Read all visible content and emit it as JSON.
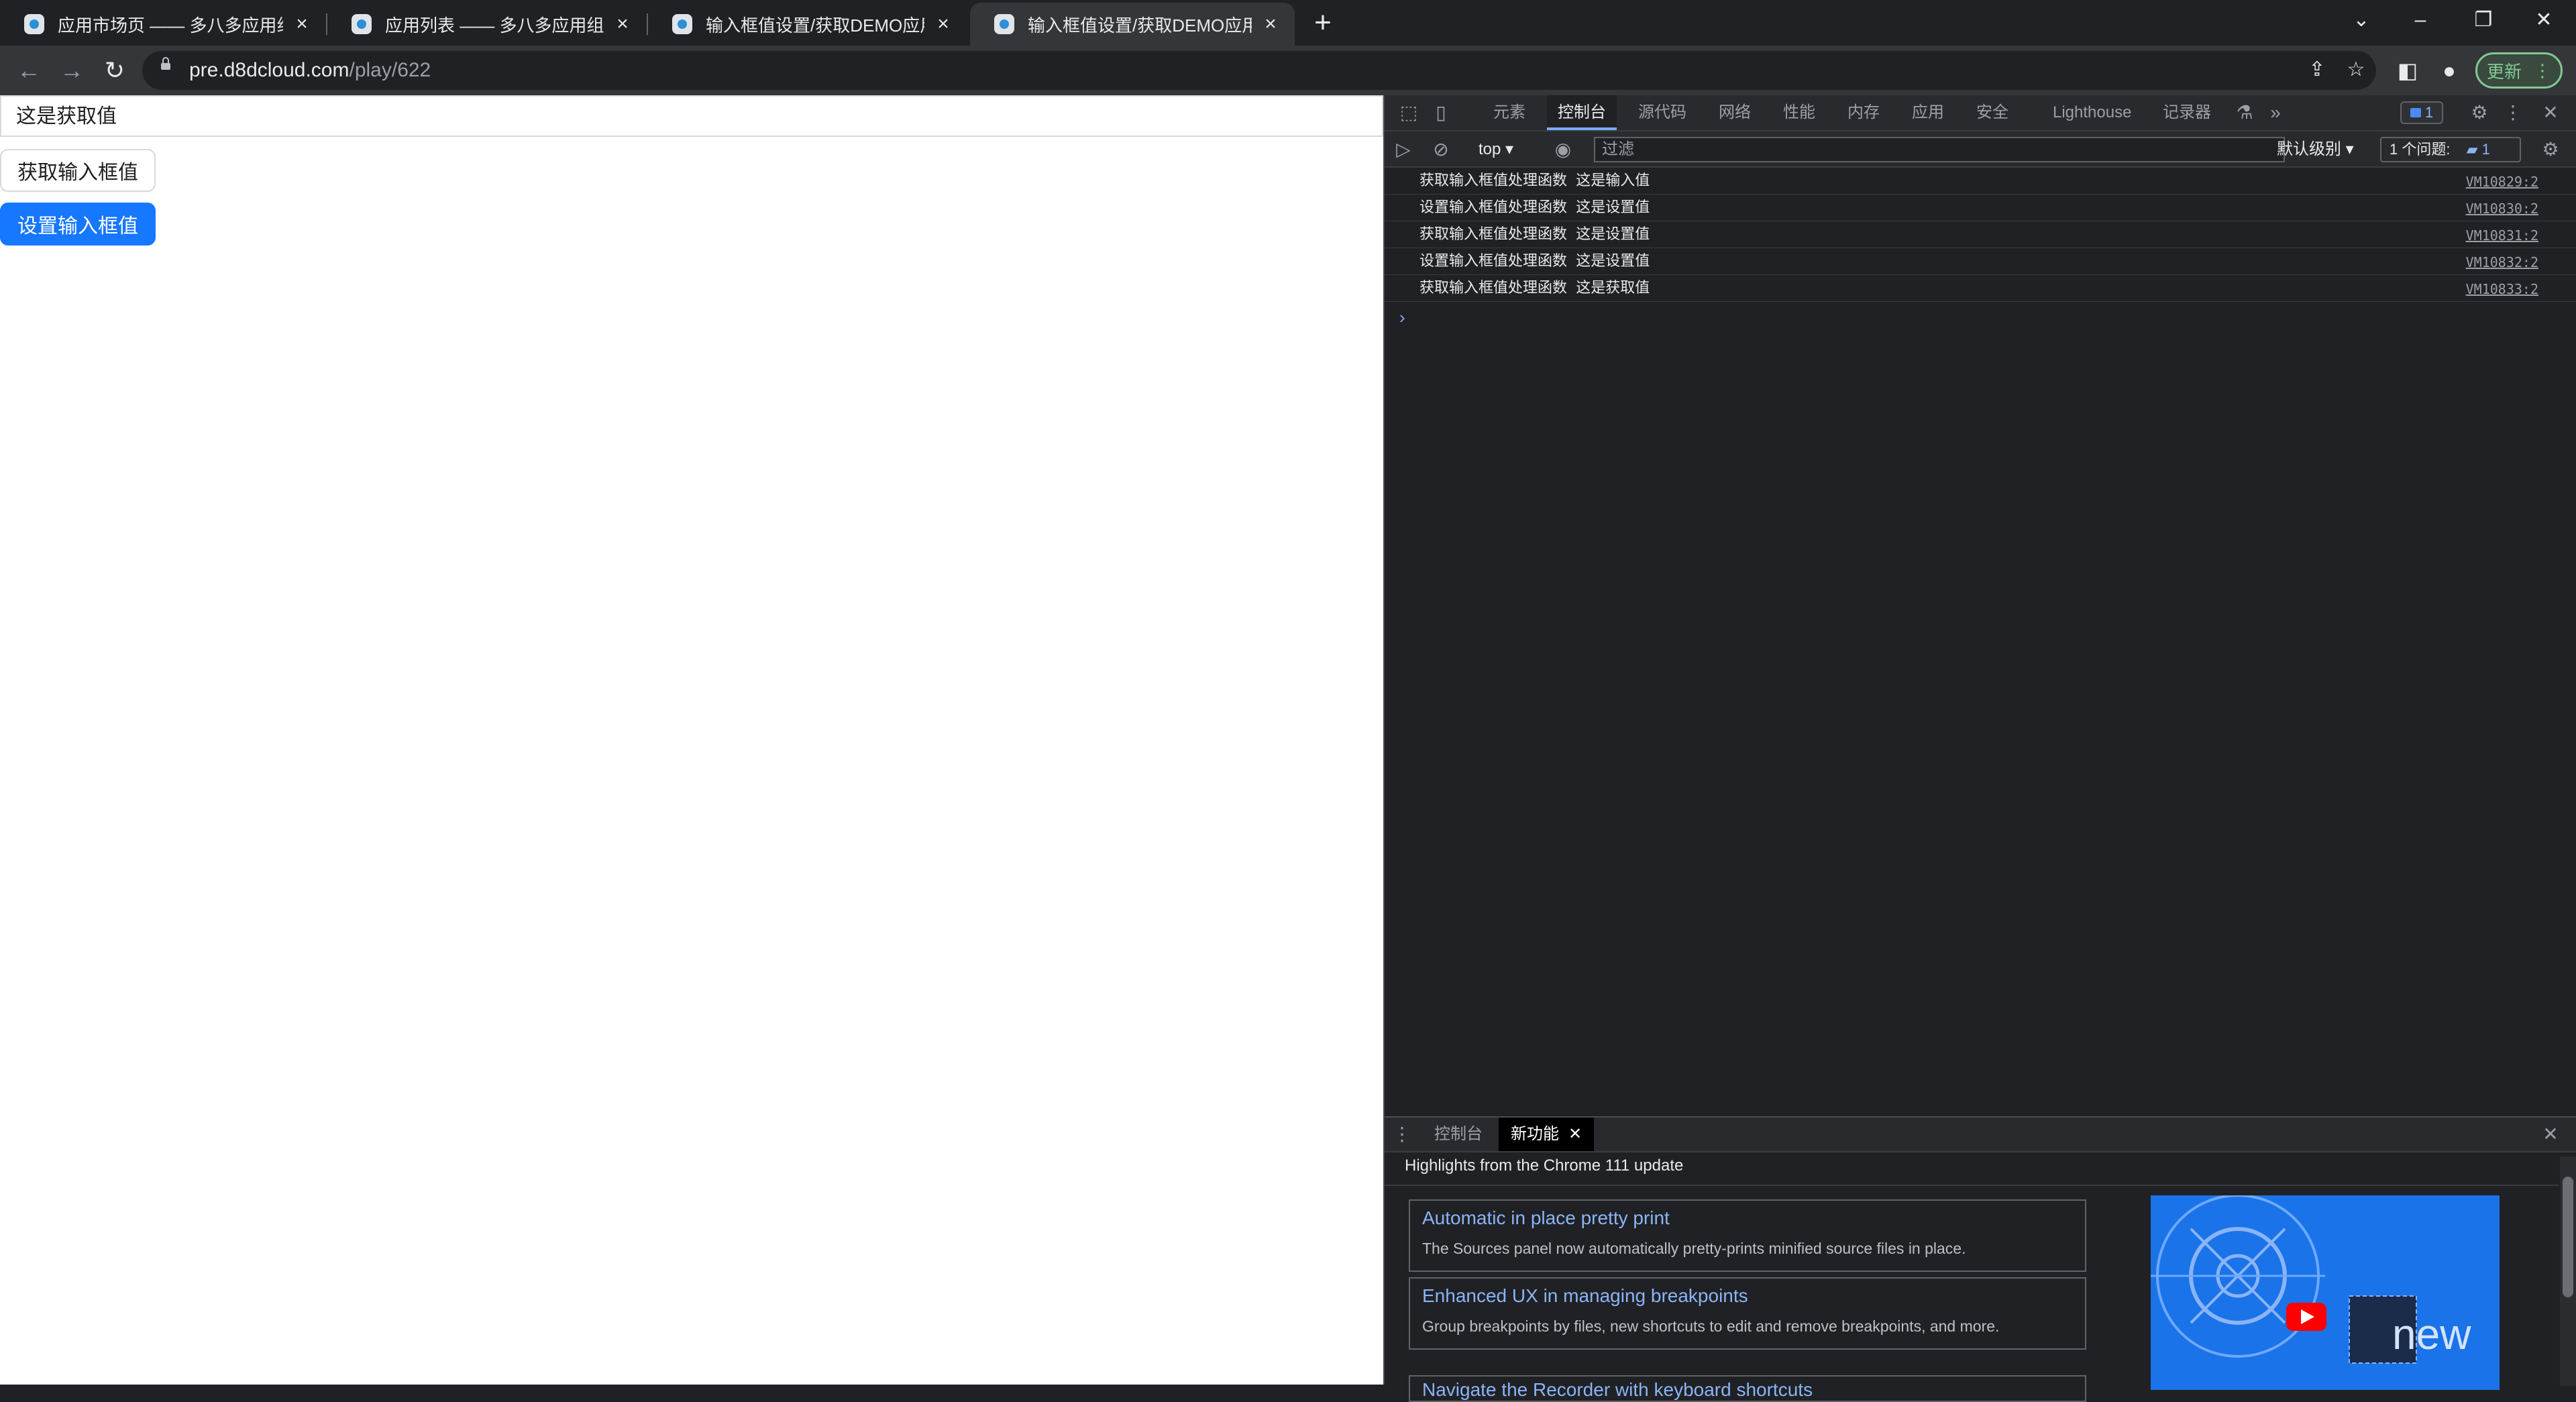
{
  "browser": {
    "tabs": [
      {
        "label": "应用市场页 —— 多八多应用组件"
      },
      {
        "label": "应用列表 —— 多八多应用组件库"
      },
      {
        "label": "输入框值设置/获取DEMO应用 —"
      },
      {
        "label": "输入框值设置/获取DEMO应用"
      }
    ],
    "url_host": "pre.d8dcloud.com",
    "url_path": "/play/622",
    "update_label": "更新"
  },
  "page": {
    "input_value": "这是获取值",
    "get_button": "获取输入框值",
    "set_button": "设置输入框值"
  },
  "devtools": {
    "tabs": [
      "元素",
      "控制台",
      "源代码",
      "网络",
      "性能",
      "内存",
      "应用",
      "安全",
      "Lighthouse",
      "记录器"
    ],
    "message_count": "1",
    "context": "top",
    "filter_placeholder": "过滤",
    "levels": "默认级别",
    "issues_label": "1 个问题:",
    "issues_count": "1",
    "logs": [
      {
        "msg": "获取输入框值处理函数 这是输入值",
        "src": "VM10829:2"
      },
      {
        "msg": "设置输入框值处理函数 这是设置值",
        "src": "VM10830:2"
      },
      {
        "msg": "获取输入框值处理函数 这是设置值",
        "src": "VM10831:2"
      },
      {
        "msg": "设置输入框值处理函数 这是设置值",
        "src": "VM10832:2"
      },
      {
        "msg": "获取输入框值处理函数 这是获取值",
        "src": "VM10833:2"
      }
    ],
    "drawer": {
      "tabs": [
        "控制台",
        "新功能"
      ],
      "header": "Highlights from the Chrome 111 update",
      "cards": [
        {
          "title": "Automatic in place pretty print",
          "desc": "The Sources panel now automatically pretty-prints minified source files in place."
        },
        {
          "title": "Enhanced UX in managing breakpoints",
          "desc": "Group breakpoints by files, new shortcuts to edit and remove breakpoints, and more."
        },
        {
          "title": "Navigate the Recorder with keyboard shortcuts",
          "desc": ""
        }
      ],
      "video_text": "new"
    }
  },
  "colors": {
    "primary_button": "#1677ff",
    "devtools_bg": "#202124",
    "link": "#8ab4f8"
  }
}
